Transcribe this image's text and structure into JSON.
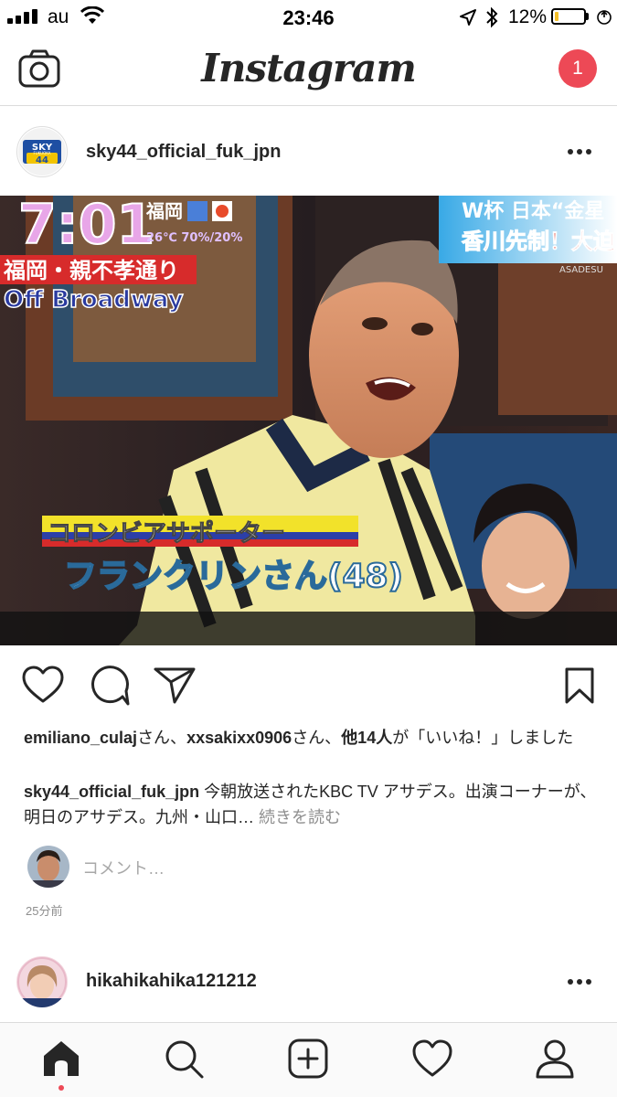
{
  "status_bar": {
    "carrier": "au",
    "time": "23:46",
    "battery_percent": "12%",
    "battery_level": 0.12,
    "battery_color": "#f5c02a"
  },
  "header": {
    "logo": "Instagram",
    "notification_count": "1",
    "notification_color": "#ed4956",
    "icons": [
      "camera-icon"
    ]
  },
  "post": {
    "avatar_text_top": "SKY",
    "avatar_text_mid": "FUKUOKA",
    "avatar_text_num": "44",
    "username": "sky44_official_fuk_jpn",
    "photo_overlay": {
      "clock": "7:01",
      "city": "福岡",
      "weather": "26℃ 70%/20%",
      "headline_red": "福岡・親不孝通り",
      "headline_sub": "Off Broadway",
      "news_top": "W杯 日本“金星",
      "news_bottom": "香川先制！大迫",
      "news_brand": "ASADESU",
      "caption_line1": "コロンビアサポーター",
      "caption_line2": "フランクリンさん(48)"
    },
    "likes": {
      "user1": "emiliano_culaj",
      "suffix1": "さん、",
      "user2": "xxsakixx0906",
      "suffix2": "さん、",
      "others": "他14人",
      "tail": "が「いいね！」しました"
    },
    "caption": {
      "user": "sky44_official_fuk_jpn",
      "text": " 今朝放送されたKBC TV アサデス。出演コーナーが、明日のアサデス。九州・山口…",
      "more": " 続きを読む"
    },
    "comment_placeholder": "コメント…",
    "timestamp": "25分前"
  },
  "next_post": {
    "username": "hikahikahika121212"
  },
  "tab_bar": {
    "tabs": [
      "home-icon",
      "search-icon",
      "add-icon",
      "heart-icon",
      "profile-icon"
    ],
    "active": "home-icon"
  }
}
